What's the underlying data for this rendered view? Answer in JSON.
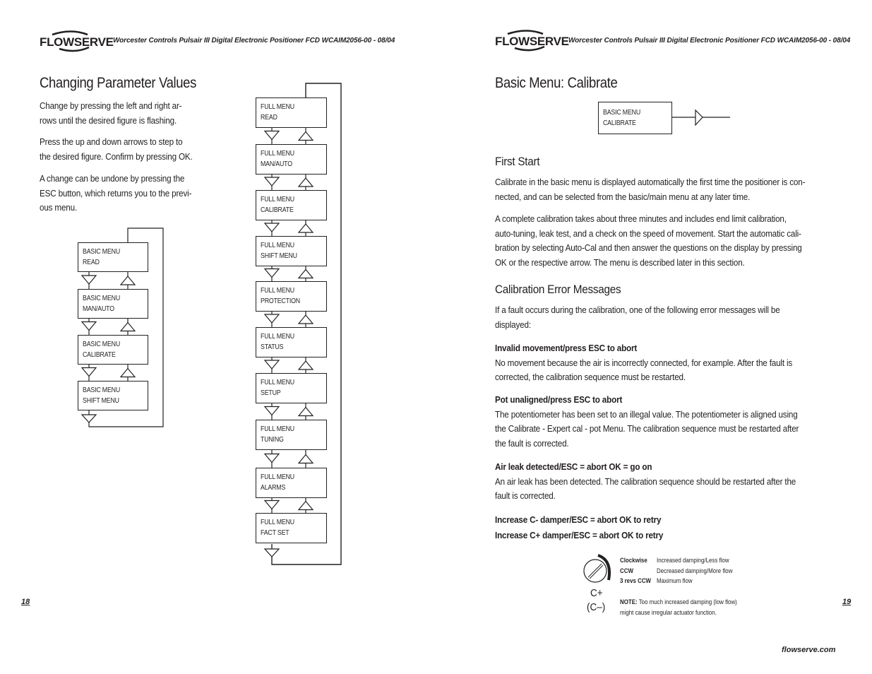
{
  "header": {
    "logo_text": "FLOWSERVE",
    "doc_title": "Worcester Controls Pulsair III Digital Electronic Positioner FCD WCAIM2056-00 - 08/04"
  },
  "left_page": {
    "title": "Changing Parameter Values",
    "paragraphs": [
      [
        "Change by pressing the left and right ar-",
        "rows until the desired figure is flashing."
      ],
      [
        "Press the up and down arrows to step to",
        "the desired figure. Confirm by pressing OK."
      ],
      [
        "A change can be undone by pressing the",
        "ESC button, which returns you to the previ-",
        "ous menu."
      ]
    ],
    "basic_menu_diagram": [
      {
        "line1": "BASIC MENU",
        "line2": "READ"
      },
      {
        "line1": "BASIC MENU",
        "line2": "MAN/AUTO"
      },
      {
        "line1": "BASIC MENU",
        "line2": "CALIBRATE"
      },
      {
        "line1": "BASIC MENU",
        "line2": "SHIFT MENU"
      }
    ],
    "full_menu_diagram": [
      {
        "line1": "FULL MENU",
        "line2": "READ"
      },
      {
        "line1": "FULL MENU",
        "line2": "MAN/AUTO"
      },
      {
        "line1": "FULL MENU",
        "line2": "CALIBRATE"
      },
      {
        "line1": "FULL MENU",
        "line2": "SHIFT MENU"
      },
      {
        "line1": "FULL MENU",
        "line2": "PROTECTION"
      },
      {
        "line1": "FULL MENU",
        "line2": "STATUS"
      },
      {
        "line1": "FULL MENU",
        "line2": "SETUP"
      },
      {
        "line1": "FULL MENU",
        "line2": "TUNING"
      },
      {
        "line1": "FULL MENU",
        "line2": "ALARMS"
      },
      {
        "line1": "FULL MENU",
        "line2": "FACT SET"
      }
    ],
    "page_number": "18"
  },
  "right_page": {
    "title": "Basic Menu: Calibrate",
    "calibrate_box": {
      "line1": "BASIC MENU",
      "line2": "CALIBRATE"
    },
    "first_start": {
      "heading": "First Start",
      "paragraphs": [
        [
          "Calibrate in the basic menu is displayed automatically the first time the positioner is con-",
          "nected, and can be selected from the basic/main menu at any later time."
        ],
        [
          "A complete calibration takes about three minutes and includes end limit calibration,",
          "auto-tuning, leak test, and a check on the speed of movement. Start the automatic cali-",
          "bration by selecting Auto-Cal and then answer the questions on the display by pressing",
          "OK or the respective arrow. The menu is described later in this section."
        ]
      ]
    },
    "errors": {
      "heading": "Calibration Error Messages",
      "intro": [
        "If a fault occurs during the calibration, one of the following error messages will be",
        "displayed:"
      ],
      "items": [
        {
          "title": "Invalid movement/press ESC to abort",
          "body": [
            "No movement because the air is incorrectly connected, for example. After the fault is",
            "corrected, the calibration sequence must be restarted."
          ]
        },
        {
          "title": "Pot unaligned/press ESC to abort",
          "body": [
            "The potentiometer has been set to an illegal value. The potentiometer is aligned using",
            "the Calibrate - Expert cal - pot Menu. The calibration sequence must be restarted after",
            "the fault is corrected."
          ]
        },
        {
          "title": "Air leak detected/ESC = abort OK = go on",
          "body": [
            "An air leak has been detected. The calibration sequence should be restarted after the",
            "fault is corrected."
          ]
        }
      ],
      "damper_lines": [
        "Increase C- damper/ESC = abort OK to retry",
        "Increase C+ damper/ESC = abort OK to retry"
      ]
    },
    "damper_figure": {
      "label_top": "C+",
      "label_bottom": "(C–)",
      "rows": [
        {
          "key": "Clockwise",
          "value": "Increased damping/Less flow"
        },
        {
          "key": "CCW",
          "value": "Decreased damping/More flow"
        },
        {
          "key": "3 revs CCW",
          "value": "Maximum flow"
        }
      ],
      "note_label": "NOTE:",
      "note_text": [
        "Too much increased damping (low flow)",
        "might cause irregular actuator function."
      ]
    },
    "page_number": "19",
    "footer_url": "flowserve.com"
  }
}
